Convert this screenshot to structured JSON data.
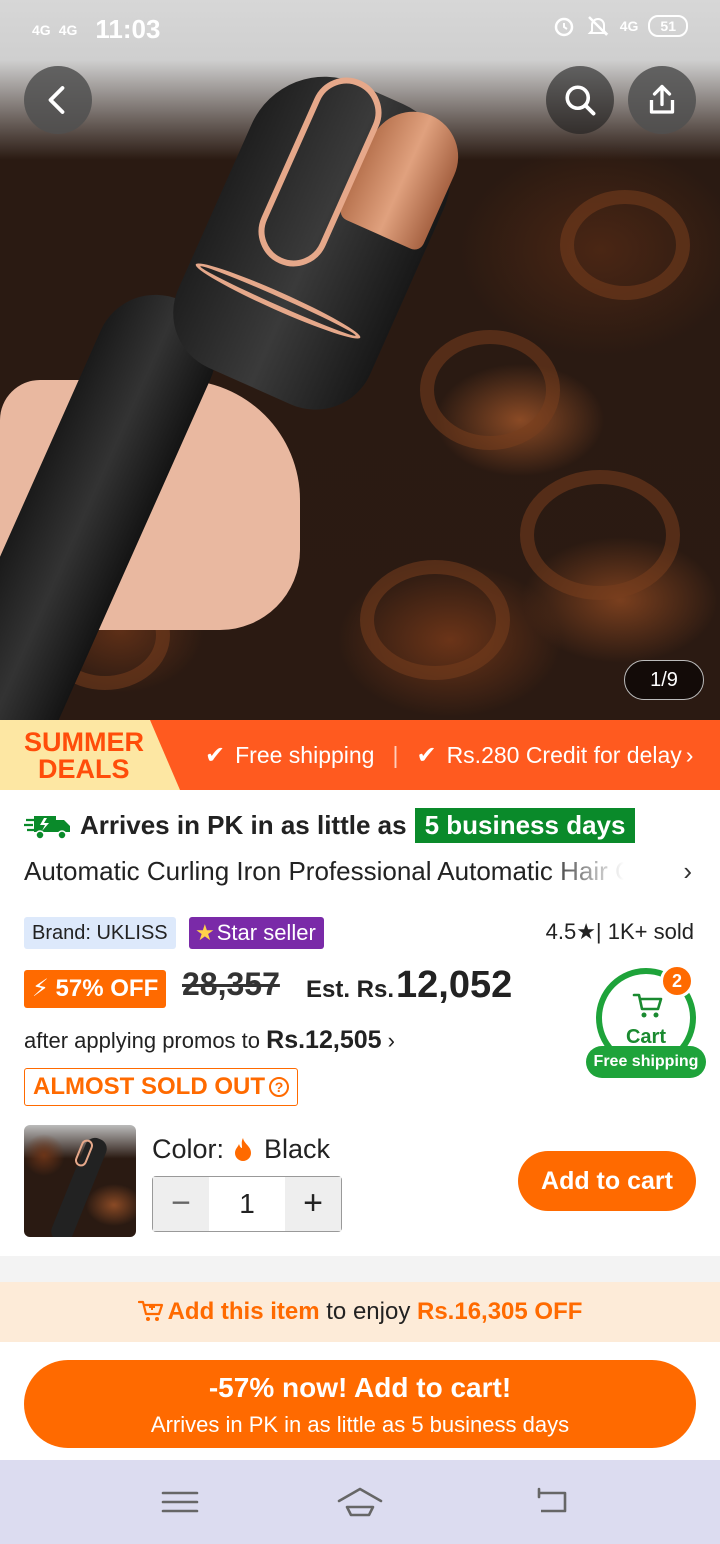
{
  "status_bar": {
    "signal1": "4G",
    "signal2": "4G",
    "time": "11:03",
    "network": "4G",
    "battery": "51"
  },
  "gallery": {
    "counter": "1/9"
  },
  "promo": {
    "badge_line1": "SUMMER",
    "badge_line2": "DEALS",
    "item1": "Free shipping",
    "item2": "Rs.280 Credit for delay",
    "chevron": "›"
  },
  "delivery": {
    "prefix": "Arrives in PK in as little as",
    "days": "5 business days"
  },
  "product": {
    "title": "Automatic Curling Iron Professional Automatic Hair Curler",
    "brand": "Brand: UKLISS",
    "star_seller": "Star seller",
    "rating": "4.5★| 1K+ sold",
    "discount": "57% OFF",
    "original_price": "28,357",
    "est_label": "Est. Rs.",
    "est_price": "12,052",
    "after_promo_text": "after applying promos to",
    "after_promo_price": "Rs.12,505",
    "almost_sold_out": "ALMOST SOLD OUT",
    "color_label": "Color:",
    "color_value": "Black",
    "quantity": "1",
    "add_to_cart": "Add to cart"
  },
  "cart": {
    "label": "Cart",
    "count": "2",
    "free_shipping": "Free shipping"
  },
  "bundle": {
    "action": "Add this item",
    "middle": "to enjoy",
    "amount": "Rs.16,305 OFF"
  },
  "cta": {
    "line1": "-57% now! Add to cart!",
    "line2": "Arrives in PK in as little as 5 business days"
  },
  "colors": {
    "accent": "#ff6a00",
    "promo": "#ff5a1f",
    "green": "#1ea33a",
    "purple": "#7a2aa8"
  }
}
